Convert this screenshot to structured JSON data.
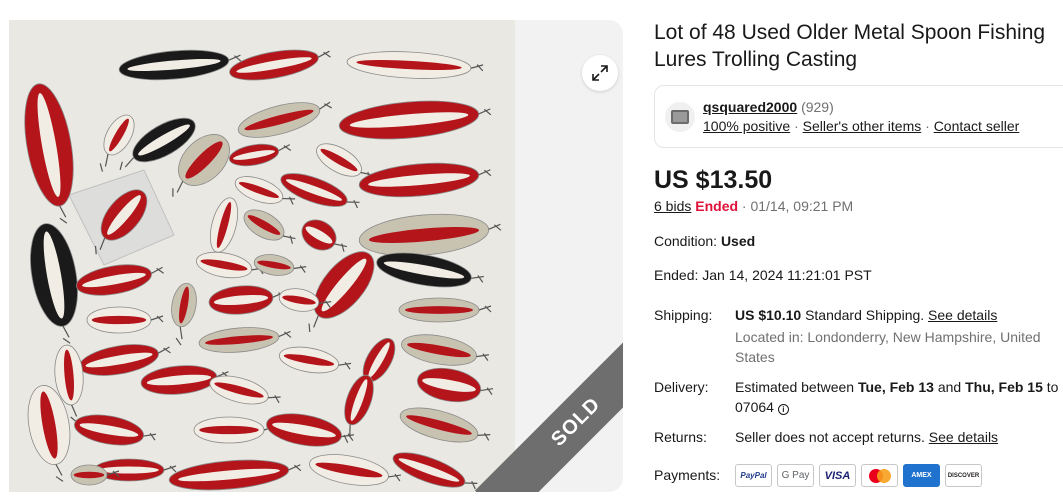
{
  "listing": {
    "title": "Lot of 48 Used Older Metal Spoon Fishing Lures Trolling Casting",
    "sold_label": "SOLD",
    "expand_icon": "expand-arrows-icon",
    "photo_colors": {
      "red": "#b3151a",
      "white": "#f1ede4",
      "black": "#1a1a1a",
      "metal": "#c8c2b1",
      "bag": "#e3e3e3"
    }
  },
  "seller": {
    "name": "qsquared2000",
    "feedback_count": "(929)",
    "positive": "100% positive",
    "other_items": "Seller's other items",
    "contact": "Contact seller",
    "separator": "·"
  },
  "price": {
    "amount": "US $13.50",
    "bids": "6 bids",
    "status": "Ended",
    "ended_short": "· 01/14, 09:21 PM"
  },
  "details": {
    "condition_label": "Condition:",
    "condition_value": "Used",
    "ended_label": "Ended:",
    "ended_value": "Jan 14, 2024 11:21:01 PST",
    "shipping_label": "Shipping:",
    "shipping_cost": "US $10.10",
    "shipping_method": "Standard Shipping.",
    "shipping_link": "See details",
    "location": "Located in: Londonderry, New Hampshire, United States",
    "delivery_label": "Delivery:",
    "delivery_prefix": "Estimated between",
    "delivery_start": "Tue, Feb 13",
    "delivery_and": "and",
    "delivery_end": "Thu, Feb 15",
    "delivery_to": "to",
    "delivery_zip": "07064",
    "returns_label": "Returns:",
    "returns_value": "Seller does not accept returns.",
    "returns_link": "See details",
    "payments_label": "Payments:",
    "payment_methods": [
      "PayPal",
      "G Pay",
      "VISA",
      "Mastercard",
      "AMEX",
      "DISCOVER"
    ]
  },
  "colors": {
    "ended_red": "#e0103a",
    "muted": "#707070",
    "text": "#191919",
    "ribbon": "#6e6e6e"
  }
}
